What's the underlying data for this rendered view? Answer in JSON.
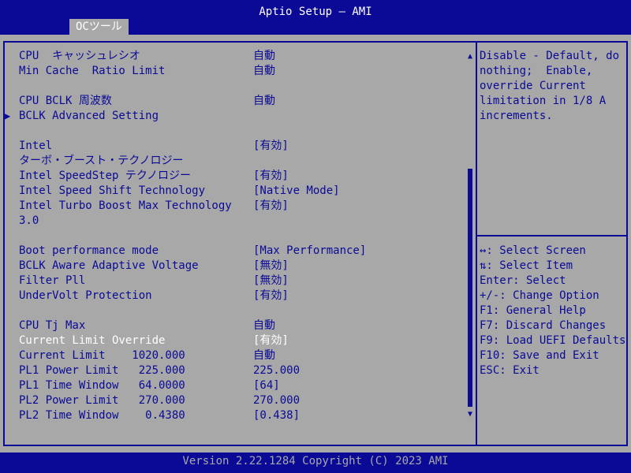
{
  "title": "Aptio Setup – AMI",
  "tab": "OCツール",
  "settings": [
    {
      "label": "CPU  キャッシュレシオ",
      "value": "自動"
    },
    {
      "label": "Min Cache  Ratio Limit",
      "value": "自動"
    },
    {
      "label": "CPU BCLK 周波数",
      "value": "自動"
    },
    {
      "label": "BCLK Advanced Setting",
      "value": ""
    },
    {
      "label": "Intel",
      "value": "[有効]"
    },
    {
      "label": "ターボ・ブースト・テクノロジー",
      "value": ""
    },
    {
      "label": "Intel SpeedStep テクノロジー",
      "value": "[有効]"
    },
    {
      "label": "Intel Speed Shift Technology",
      "value": "[Native Mode]"
    },
    {
      "label": "Intel Turbo Boost Max Technology",
      "value": "[有効]"
    },
    {
      "label": "3.0",
      "value": ""
    },
    {
      "label": "Boot performance mode",
      "value": "[Max Performance]"
    },
    {
      "label": "BCLK Aware Adaptive Voltage",
      "value": "[無効]"
    },
    {
      "label": "Filter Pll",
      "value": "[無効]"
    },
    {
      "label": "UnderVolt Protection",
      "value": "[有効]"
    },
    {
      "label": "CPU Tj Max",
      "value": "自動"
    },
    {
      "label": "Current Limit Override",
      "value": "[有効]"
    },
    {
      "label": "Current Limit    1020.000",
      "value": "自動"
    },
    {
      "label": "PL1 Power Limit   225.000",
      "value": "225.000"
    },
    {
      "label": "PL1 Time Window   64.0000",
      "value": "[64]"
    },
    {
      "label": "PL2 Power Limit   270.000",
      "value": "270.000"
    },
    {
      "label": "PL2 Time Window    0.4380",
      "value": "[0.438]"
    }
  ],
  "help_lines": [
    "Disable - Default, do",
    "nothing;  Enable,",
    "override Current",
    "limitation in 1/8 A",
    "increments."
  ],
  "keys": [
    "↔: Select Screen",
    "⇅: Select Item",
    "Enter: Select",
    "+/-: Change Option",
    "F1: General Help",
    "F7: Discard Changes",
    "F9: Load UEFI Defaults",
    "F10: Save and Exit",
    "ESC: Exit"
  ],
  "footer": "Version 2.22.1284 Copyright (C) 2023 AMI",
  "scrollbar": {
    "position": 0.3
  },
  "colors": {
    "background": "#a8a8a8",
    "accent": "#0a0a96",
    "selected": "#ffffff"
  }
}
